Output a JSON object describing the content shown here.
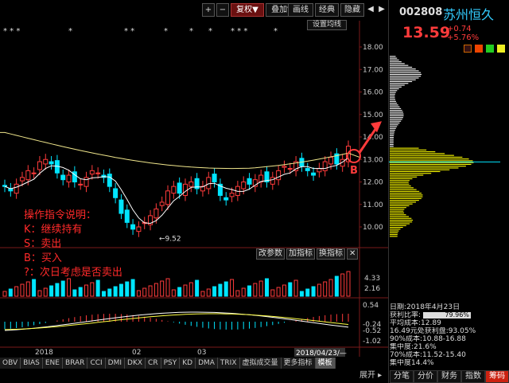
{
  "toolbar": {
    "plus": "+",
    "minus": "−",
    "fuquan": "复权▼",
    "diejia": "叠加▼",
    "huaxian": "画线",
    "jingdian": "经典",
    "yincang": "隐藏",
    "back": "◀",
    "forward": "▶",
    "shezhi": "设置均线"
  },
  "stock": {
    "code": "002808",
    "name": "苏州恒久",
    "price": "13.59",
    "change": "+0.74",
    "change_pct": "+5.76%"
  },
  "chart_data": {
    "type": "candlestick",
    "price_axis": [
      "18.00",
      "17.00",
      "16.00",
      "15.00",
      "14.00",
      "13.00",
      "12.00",
      "11.00",
      "10.00"
    ],
    "low_label": "9.52",
    "volume_axis": [
      "4.33",
      "2.16"
    ],
    "macd_axis": [
      "0.54",
      "-0.24",
      "-0.52",
      "-1.02"
    ],
    "date_labels": [
      "2018",
      "02",
      "03"
    ],
    "cursor_date": "2018/04/23/—",
    "stars": [
      "* * *",
      "*",
      "* *",
      "*",
      "*",
      "*",
      "* * *",
      "*"
    ],
    "buy_marker": "B",
    "closes": [
      11.8,
      11.6,
      11.9,
      12.2,
      12.5,
      12.4,
      12.9,
      13.0,
      12.8,
      12.4,
      12.1,
      12.3,
      12.0,
      11.9,
      12.2,
      12.5,
      12.4,
      12.2,
      11.8,
      11.3,
      10.6,
      10.2,
      9.9,
      10.0,
      10.2,
      10.5,
      10.8,
      11.1,
      11.6,
      11.8,
      11.5,
      11.9,
      12.0,
      11.7,
      11.8,
      12.2,
      12.0,
      11.4,
      11.2,
      11.5,
      11.8,
      12.0,
      11.9,
      12.1,
      12.3,
      12.0,
      12.2,
      12.5,
      12.7,
      12.6,
      12.9,
      12.7,
      12.5,
      12.3,
      12.6,
      12.9,
      13.1,
      12.8,
      13.0,
      13.59
    ]
  },
  "annotation": {
    "title": "操作指令说明：",
    "k": "K：继续持有",
    "s": "S：卖出",
    "b": "B：买入",
    "q": "?：次日考虑是否卖出"
  },
  "small_buttons": [
    "改参数",
    "加指标",
    "换指标",
    "✕"
  ],
  "profile": {
    "date": "日期:2018年4月23日",
    "profit_label": "获利比率:",
    "profit_value": "79.96%",
    "avg_cost": "平均成本:12.89",
    "profit_line": "16.49元处获利盘:93.05%",
    "cost90": "90%成本:10.88-16.88",
    "conc90": "集中度:21.6%",
    "cost70": "70%成本:11.52-15.40",
    "conc70": "集中度14.4%"
  },
  "bottom_tabs": [
    "OBV",
    "BIAS",
    "ENE",
    "BRAR",
    "CCI",
    "DMI",
    "DKX",
    "CR",
    "PSY",
    "KD",
    "DMA",
    "TRIX",
    "虚拟成交量",
    "更多指标",
    "模板"
  ],
  "bottom_expand": "展开 ▸",
  "right_tabs": [
    "分笔",
    "分价",
    "财务",
    "指数",
    "筹码"
  ],
  "colors": {
    "up": "#ff3b3b",
    "down": "#00e5ff",
    "ma": "#f0e68c",
    "cost": "#ffff00"
  }
}
